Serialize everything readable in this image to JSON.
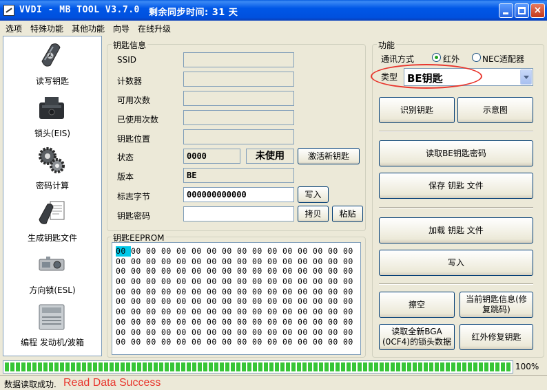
{
  "window": {
    "title": "VVDI - MB TOOL V3.7.0",
    "sync_text": "剩余同步时间: 31 天",
    "close_glyph": "×"
  },
  "menu": [
    "选项",
    "特殊功能",
    "其他功能",
    "向导",
    "在线升级"
  ],
  "sidebar": {
    "items": [
      {
        "label": "读写钥匙",
        "icon": "mercedes-key-icon"
      },
      {
        "label": "锁头(EIS)",
        "icon": "eis-ignition-module-icon"
      },
      {
        "label": "密码计算",
        "icon": "gears-icon"
      },
      {
        "label": "生成钥匙文件",
        "icon": "key-file-icon"
      },
      {
        "label": "方向锁(ESL)",
        "icon": "esl-steering-lock-icon"
      },
      {
        "label": "编程 发动机/波箱",
        "icon": "ecu-module-icon"
      }
    ]
  },
  "key_info": {
    "title": "钥匙信息",
    "fields": {
      "ssid_label": "SSID",
      "counter_label": "计数器",
      "available_label": "可用次数",
      "used_label": "已使用次数",
      "position_label": "钥匙位置",
      "status_label": "状态",
      "status_value": "0000",
      "status_display": "未使用",
      "version_label": "版本",
      "version_value": "BE",
      "flag_label": "标志字节",
      "flag_value": "000000000000",
      "password_label": "钥匙密码"
    },
    "buttons": {
      "activate": "激活新钥匙",
      "write": "写入",
      "copy": "拷贝",
      "paste": "粘贴"
    }
  },
  "eeprom": {
    "title": "钥匙EEPROM",
    "rows": [
      [
        "00",
        "00",
        "00",
        "00",
        "00",
        "00",
        "00",
        "00",
        "00",
        "00",
        "00",
        "00",
        "00",
        "00",
        "00",
        "00"
      ],
      [
        "00",
        "00",
        "00",
        "00",
        "00",
        "00",
        "00",
        "00",
        "00",
        "00",
        "00",
        "00",
        "00",
        "00",
        "00",
        "00"
      ],
      [
        "00",
        "00",
        "00",
        "00",
        "00",
        "00",
        "00",
        "00",
        "00",
        "00",
        "00",
        "00",
        "00",
        "00",
        "00",
        "00"
      ],
      [
        "00",
        "00",
        "00",
        "00",
        "00",
        "00",
        "00",
        "00",
        "00",
        "00",
        "00",
        "00",
        "00",
        "00",
        "00",
        "00"
      ],
      [
        "00",
        "00",
        "00",
        "00",
        "00",
        "00",
        "00",
        "00",
        "00",
        "00",
        "00",
        "00",
        "00",
        "00",
        "00",
        "00"
      ],
      [
        "00",
        "00",
        "00",
        "00",
        "00",
        "00",
        "00",
        "00",
        "00",
        "00",
        "00",
        "00",
        "00",
        "00",
        "00",
        "00"
      ],
      [
        "00",
        "00",
        "00",
        "00",
        "00",
        "00",
        "00",
        "00",
        "00",
        "00",
        "00",
        "00",
        "00",
        "00",
        "00",
        "00"
      ],
      [
        "00",
        "00",
        "00",
        "00",
        "00",
        "00",
        "00",
        "00",
        "00",
        "00",
        "00",
        "00",
        "00",
        "00",
        "00",
        "00"
      ],
      [
        "00",
        "00",
        "00",
        "00",
        "00",
        "00",
        "00",
        "00",
        "00",
        "00",
        "00",
        "00",
        "00",
        "00",
        "00",
        "00"
      ],
      [
        "00",
        "00",
        "00",
        "00",
        "00",
        "00",
        "00",
        "00",
        "00",
        "00",
        "00",
        "00",
        "00",
        "00",
        "00",
        "00"
      ]
    ]
  },
  "functions": {
    "title": "功能",
    "comm_label": "通讯方式",
    "comm_options": [
      "红外",
      "NEC适配器"
    ],
    "type_label": "类型",
    "type_value": "BE钥匙",
    "highlight_color": "#e8362d",
    "buttons": {
      "identify": "识别钥匙",
      "diagram": "示意图",
      "read_password": "读取BE钥匙密码",
      "save_file": "保存 钥匙 文件",
      "load_file": "加载 钥匙 文件",
      "write": "写入",
      "erase": "擦空",
      "current_info": "当前钥匙信息(修复跳码)",
      "read_new_bga": "读取全新BGA (0CF4)的锁头数据",
      "ir_repair": "红外修复钥匙"
    }
  },
  "progress": {
    "value": 1.0,
    "label": "100%",
    "color": "#37c537"
  },
  "status": {
    "text": "数据读取成功.",
    "annotation": "Read Data Success"
  }
}
